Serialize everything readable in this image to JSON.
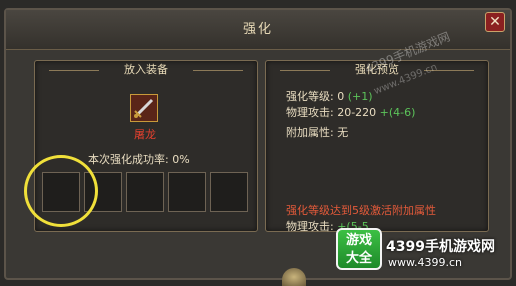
{
  "window": {
    "title": "强化",
    "close_label": "✕"
  },
  "left_panel": {
    "header": "放入装备",
    "item_name": "屠龙",
    "success_rate_label": "本次强化成功率:",
    "success_rate_value": "0%",
    "material_slots": 5
  },
  "right_panel": {
    "header": "强化预览",
    "level_label": "强化等级: 0",
    "level_bonus": "(+1)",
    "attack_label": "物理攻击: 20-220",
    "attack_bonus": "+(4-6)",
    "extra_label": "附加属性: 无",
    "requirement": "强化等级达到5级激活附加属性",
    "req_attack_label": "物理攻击:",
    "req_attack_bonus": "+(5-5"
  },
  "watermark": {
    "line1": "4399手机游戏网",
    "line2": "www.4399.cn"
  },
  "logo": {
    "badge": "游戏大全",
    "brand": "4399手机游戏网",
    "url": "www.4399.cn"
  },
  "colors": {
    "item_name": "#e3402e",
    "bonus": "#5cc45a",
    "highlight": "#f0e03a",
    "requirement": "#e35a3a"
  }
}
